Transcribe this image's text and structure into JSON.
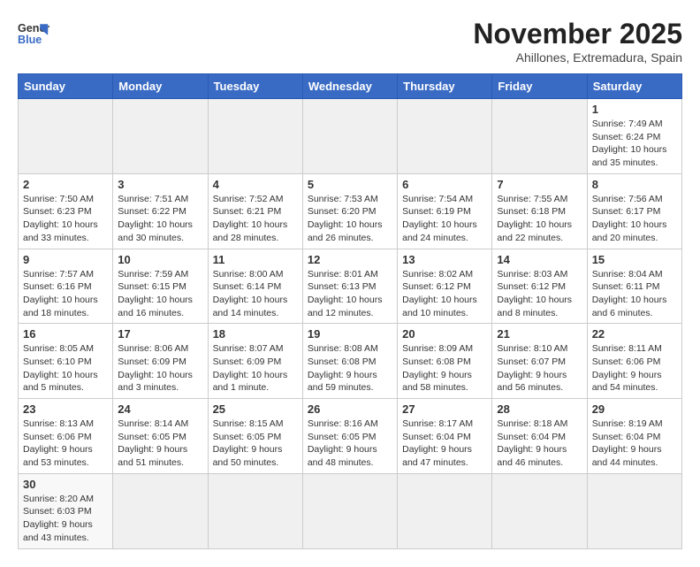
{
  "header": {
    "logo_line1": "General",
    "logo_line2": "Blue",
    "month_year": "November 2025",
    "location": "Ahillones, Extremadura, Spain"
  },
  "weekdays": [
    "Sunday",
    "Monday",
    "Tuesday",
    "Wednesday",
    "Thursday",
    "Friday",
    "Saturday"
  ],
  "weeks": [
    [
      {
        "day": "",
        "info": ""
      },
      {
        "day": "",
        "info": ""
      },
      {
        "day": "",
        "info": ""
      },
      {
        "day": "",
        "info": ""
      },
      {
        "day": "",
        "info": ""
      },
      {
        "day": "",
        "info": ""
      },
      {
        "day": "1",
        "info": "Sunrise: 7:49 AM\nSunset: 6:24 PM\nDaylight: 10 hours and 35 minutes."
      }
    ],
    [
      {
        "day": "2",
        "info": "Sunrise: 7:50 AM\nSunset: 6:23 PM\nDaylight: 10 hours and 33 minutes."
      },
      {
        "day": "3",
        "info": "Sunrise: 7:51 AM\nSunset: 6:22 PM\nDaylight: 10 hours and 30 minutes."
      },
      {
        "day": "4",
        "info": "Sunrise: 7:52 AM\nSunset: 6:21 PM\nDaylight: 10 hours and 28 minutes."
      },
      {
        "day": "5",
        "info": "Sunrise: 7:53 AM\nSunset: 6:20 PM\nDaylight: 10 hours and 26 minutes."
      },
      {
        "day": "6",
        "info": "Sunrise: 7:54 AM\nSunset: 6:19 PM\nDaylight: 10 hours and 24 minutes."
      },
      {
        "day": "7",
        "info": "Sunrise: 7:55 AM\nSunset: 6:18 PM\nDaylight: 10 hours and 22 minutes."
      },
      {
        "day": "8",
        "info": "Sunrise: 7:56 AM\nSunset: 6:17 PM\nDaylight: 10 hours and 20 minutes."
      }
    ],
    [
      {
        "day": "9",
        "info": "Sunrise: 7:57 AM\nSunset: 6:16 PM\nDaylight: 10 hours and 18 minutes."
      },
      {
        "day": "10",
        "info": "Sunrise: 7:59 AM\nSunset: 6:15 PM\nDaylight: 10 hours and 16 minutes."
      },
      {
        "day": "11",
        "info": "Sunrise: 8:00 AM\nSunset: 6:14 PM\nDaylight: 10 hours and 14 minutes."
      },
      {
        "day": "12",
        "info": "Sunrise: 8:01 AM\nSunset: 6:13 PM\nDaylight: 10 hours and 12 minutes."
      },
      {
        "day": "13",
        "info": "Sunrise: 8:02 AM\nSunset: 6:12 PM\nDaylight: 10 hours and 10 minutes."
      },
      {
        "day": "14",
        "info": "Sunrise: 8:03 AM\nSunset: 6:12 PM\nDaylight: 10 hours and 8 minutes."
      },
      {
        "day": "15",
        "info": "Sunrise: 8:04 AM\nSunset: 6:11 PM\nDaylight: 10 hours and 6 minutes."
      }
    ],
    [
      {
        "day": "16",
        "info": "Sunrise: 8:05 AM\nSunset: 6:10 PM\nDaylight: 10 hours and 5 minutes."
      },
      {
        "day": "17",
        "info": "Sunrise: 8:06 AM\nSunset: 6:09 PM\nDaylight: 10 hours and 3 minutes."
      },
      {
        "day": "18",
        "info": "Sunrise: 8:07 AM\nSunset: 6:09 PM\nDaylight: 10 hours and 1 minute."
      },
      {
        "day": "19",
        "info": "Sunrise: 8:08 AM\nSunset: 6:08 PM\nDaylight: 9 hours and 59 minutes."
      },
      {
        "day": "20",
        "info": "Sunrise: 8:09 AM\nSunset: 6:08 PM\nDaylight: 9 hours and 58 minutes."
      },
      {
        "day": "21",
        "info": "Sunrise: 8:10 AM\nSunset: 6:07 PM\nDaylight: 9 hours and 56 minutes."
      },
      {
        "day": "22",
        "info": "Sunrise: 8:11 AM\nSunset: 6:06 PM\nDaylight: 9 hours and 54 minutes."
      }
    ],
    [
      {
        "day": "23",
        "info": "Sunrise: 8:13 AM\nSunset: 6:06 PM\nDaylight: 9 hours and 53 minutes."
      },
      {
        "day": "24",
        "info": "Sunrise: 8:14 AM\nSunset: 6:05 PM\nDaylight: 9 hours and 51 minutes."
      },
      {
        "day": "25",
        "info": "Sunrise: 8:15 AM\nSunset: 6:05 PM\nDaylight: 9 hours and 50 minutes."
      },
      {
        "day": "26",
        "info": "Sunrise: 8:16 AM\nSunset: 6:05 PM\nDaylight: 9 hours and 48 minutes."
      },
      {
        "day": "27",
        "info": "Sunrise: 8:17 AM\nSunset: 6:04 PM\nDaylight: 9 hours and 47 minutes."
      },
      {
        "day": "28",
        "info": "Sunrise: 8:18 AM\nSunset: 6:04 PM\nDaylight: 9 hours and 46 minutes."
      },
      {
        "day": "29",
        "info": "Sunrise: 8:19 AM\nSunset: 6:04 PM\nDaylight: 9 hours and 44 minutes."
      }
    ],
    [
      {
        "day": "30",
        "info": "Sunrise: 8:20 AM\nSunset: 6:03 PM\nDaylight: 9 hours and 43 minutes."
      },
      {
        "day": "",
        "info": ""
      },
      {
        "day": "",
        "info": ""
      },
      {
        "day": "",
        "info": ""
      },
      {
        "day": "",
        "info": ""
      },
      {
        "day": "",
        "info": ""
      },
      {
        "day": "",
        "info": ""
      }
    ]
  ]
}
